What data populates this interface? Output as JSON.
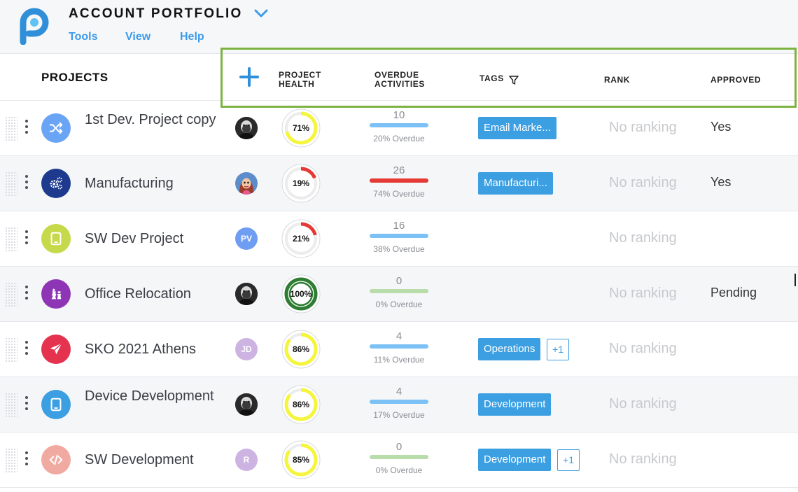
{
  "app": {
    "title": "ACCOUNT PORTFOLIO",
    "menus": [
      "Tools",
      "View",
      "Help"
    ]
  },
  "header": {
    "projects": "PROJECTS",
    "health": "PROJECT HEALTH",
    "overdue": "OVERDUE ACTIVITIES",
    "tags": "TAGS",
    "rank": "RANK",
    "approved": "APPROVED"
  },
  "colors": {
    "accent": "#3d9be9",
    "highlight": "#7cb342",
    "good": "#3b9fe2",
    "bad": "#e53935",
    "neutral": "#b8dcaa"
  },
  "projects": [
    {
      "name": "1st Dev. Project copy",
      "icon": "shuffle-icon",
      "icon_color": "#6aa4f5",
      "avatar": {
        "type": "photo",
        "initials": ""
      },
      "health": "71%",
      "health_value": 0.71,
      "health_color": "#f5f53d",
      "overdue_count": "10",
      "overdue_pct": "20% Overdue",
      "overdue_color": "#7cc1f5",
      "tags": [
        "Email Marke..."
      ],
      "extra_tags": "",
      "rank": "No ranking",
      "approved": "Yes"
    },
    {
      "name": "Manufacturing",
      "icon": "gears-icon",
      "icon_color": "#1d3a8f",
      "avatar": {
        "type": "cartoon",
        "initials": ""
      },
      "health": "19%",
      "health_value": 0.19,
      "health_color": "#e53935",
      "overdue_count": "26",
      "overdue_pct": "74% Overdue",
      "overdue_color": "#e53935",
      "tags": [
        "Manufacturi..."
      ],
      "extra_tags": "",
      "rank": "No ranking",
      "approved": "Yes"
    },
    {
      "name": "SW Dev Project",
      "icon": "tablet-icon",
      "icon_color": "#c5d94a",
      "avatar": {
        "type": "initials",
        "initials": "PV",
        "color": "#6f9df2"
      },
      "health": "21%",
      "health_value": 0.21,
      "health_color": "#e53935",
      "overdue_count": "16",
      "overdue_pct": "38% Overdue",
      "overdue_color": "#7cc1f5",
      "tags": [],
      "extra_tags": "",
      "rank": "No ranking",
      "approved": ""
    },
    {
      "name": "Office Relocation",
      "icon": "chess-icon",
      "icon_color": "#8e35b5",
      "avatar": {
        "type": "photo",
        "initials": ""
      },
      "health": "100%",
      "health_value": 1.0,
      "health_color": "#2e7d32",
      "overdue_count": "0",
      "overdue_pct": "0% Overdue",
      "overdue_color": "#b8dcaa",
      "tags": [],
      "extra_tags": "",
      "rank": "No ranking",
      "approved": "Pending"
    },
    {
      "name": "SKO 2021 Athens",
      "icon": "paper-plane-icon",
      "icon_color": "#e4324f",
      "avatar": {
        "type": "initials",
        "initials": "JD",
        "color": "#cdb3e2"
      },
      "health": "86%",
      "health_value": 0.86,
      "health_color": "#f5f53d",
      "overdue_count": "4",
      "overdue_pct": "11% Overdue",
      "overdue_color": "#7cc1f5",
      "tags": [
        "Operations"
      ],
      "extra_tags": "+1",
      "rank": "No ranking",
      "approved": ""
    },
    {
      "name": "Device Development",
      "icon": "tablet-icon",
      "icon_color": "#3b9fe2",
      "avatar": {
        "type": "photo",
        "initials": ""
      },
      "health": "86%",
      "health_value": 0.86,
      "health_color": "#f5f53d",
      "overdue_count": "4",
      "overdue_pct": "17% Overdue",
      "overdue_color": "#7cc1f5",
      "tags": [
        "Development"
      ],
      "extra_tags": "",
      "rank": "No ranking",
      "approved": ""
    },
    {
      "name": "SW Development",
      "icon": "code-icon",
      "icon_color": "#f1aaa2",
      "avatar": {
        "type": "initials",
        "initials": "R",
        "color": "#cdb3e2"
      },
      "health": "85%",
      "health_value": 0.85,
      "health_color": "#f5f53d",
      "overdue_count": "0",
      "overdue_pct": "0% Overdue",
      "overdue_color": "#b8dcaa",
      "tags": [
        "Development"
      ],
      "extra_tags": "+1",
      "rank": "No ranking",
      "approved": ""
    }
  ]
}
